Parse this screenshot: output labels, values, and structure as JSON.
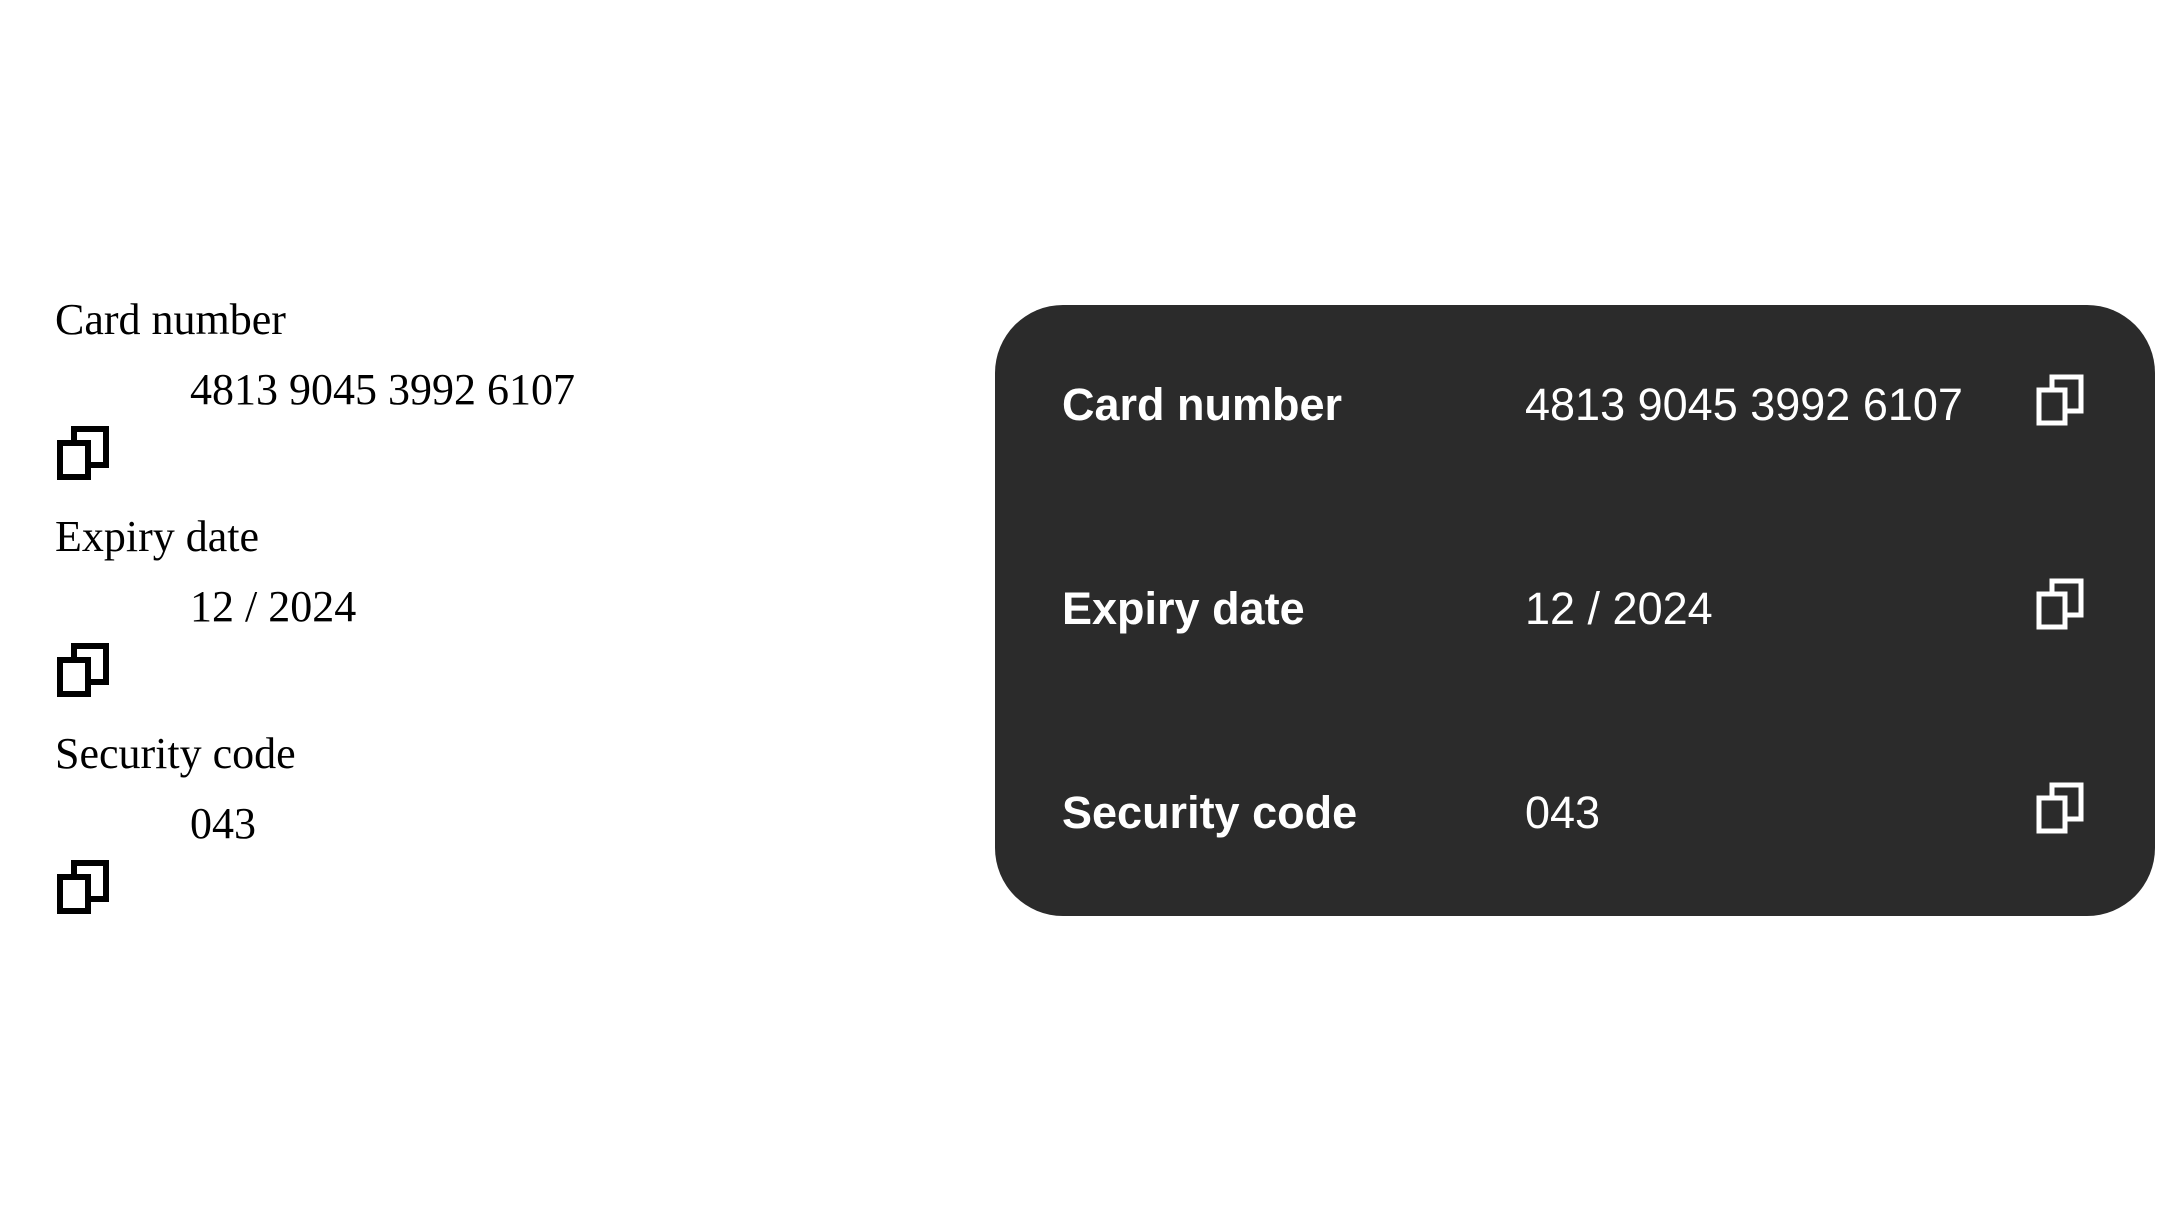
{
  "plain_view": {
    "fields": [
      {
        "label": "Card number",
        "value": "4813 9045 3992 6107",
        "icon": "copy-icon"
      },
      {
        "label": "Expiry date",
        "value": "12 / 2024",
        "icon": "copy-icon"
      },
      {
        "label": "Security code",
        "value": "043",
        "icon": "copy-icon"
      }
    ]
  },
  "card_view": {
    "background": "#2b2b2b",
    "text_color": "#ffffff",
    "fields": [
      {
        "label": "Card number",
        "value": "4813 9045 3992 6107",
        "icon": "copy-icon"
      },
      {
        "label": "Expiry date",
        "value": "12 / 2024",
        "icon": "copy-icon"
      },
      {
        "label": "Security code",
        "value": "043",
        "icon": "copy-icon"
      }
    ]
  }
}
